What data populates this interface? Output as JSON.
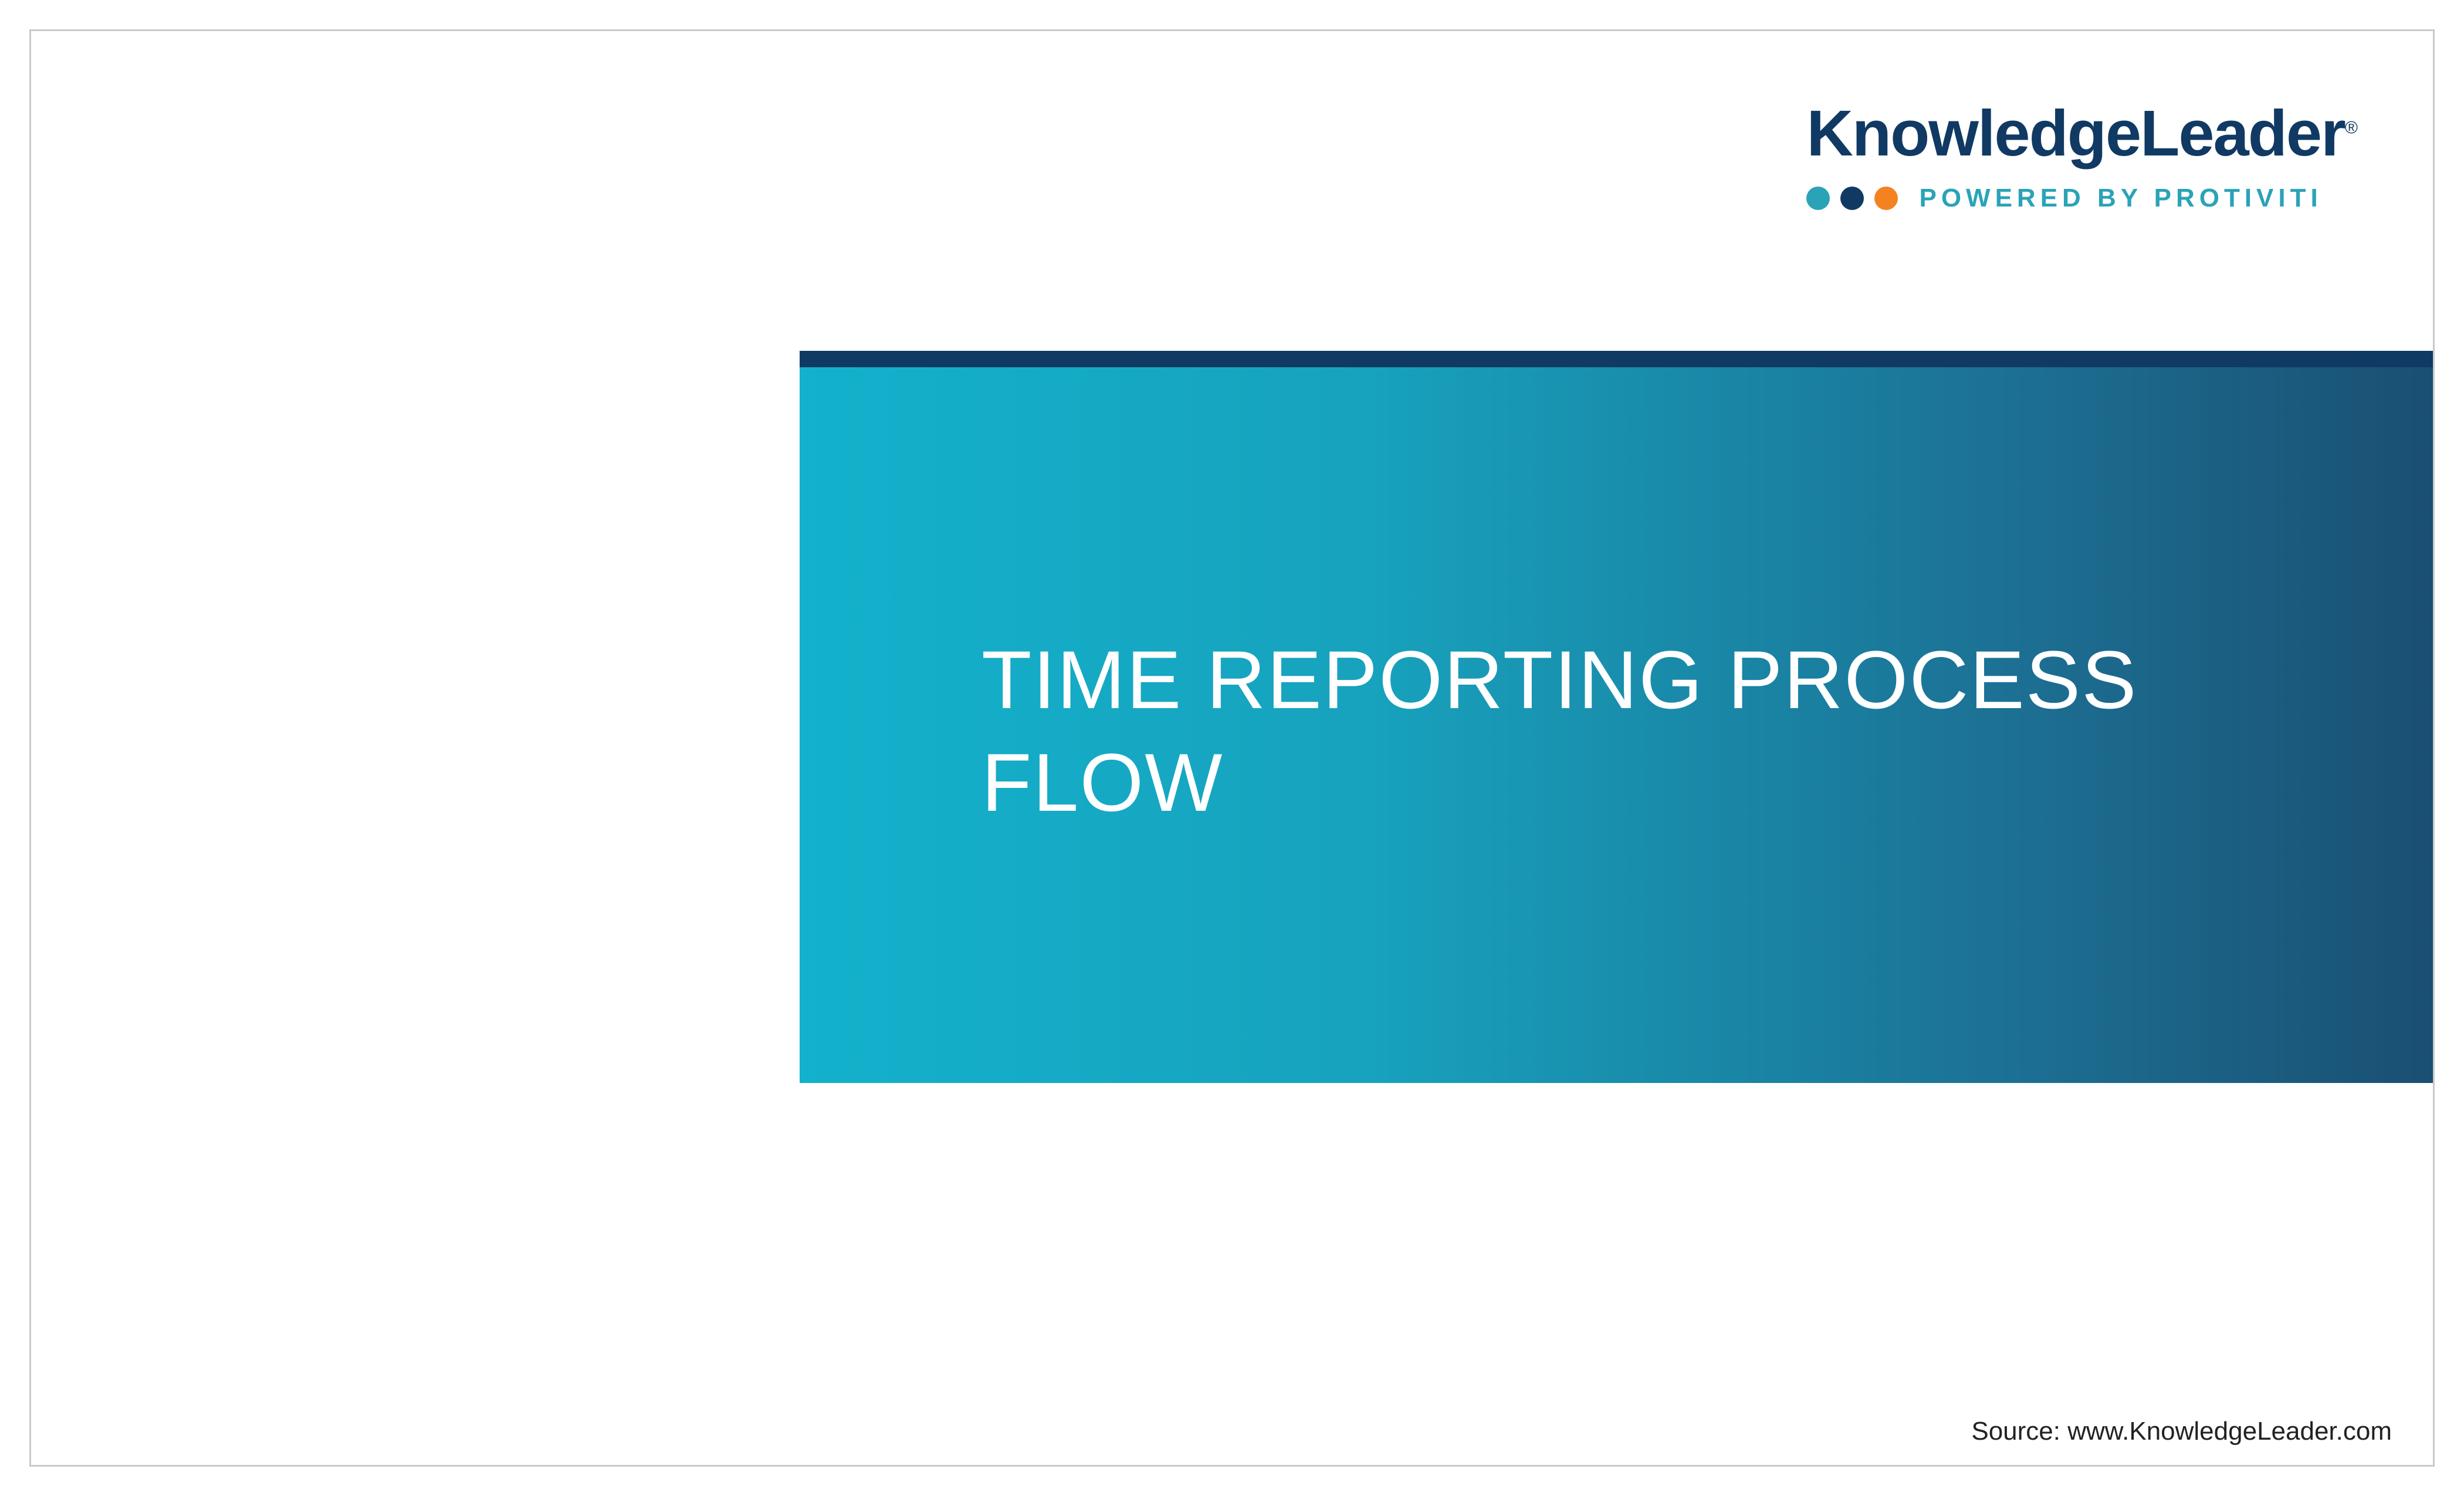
{
  "logo": {
    "brand": "KnowledgeLeader",
    "registered": "®",
    "tagline": "POWERED BY PROTIVITI"
  },
  "title": "TIME REPORTING PROCESS FLOW",
  "footer": {
    "source": "Source: www.KnowledgeLeader.com"
  },
  "colors": {
    "brand_navy": "#103a63",
    "brand_teal": "#2aa3b7",
    "brand_orange": "#f58220"
  }
}
